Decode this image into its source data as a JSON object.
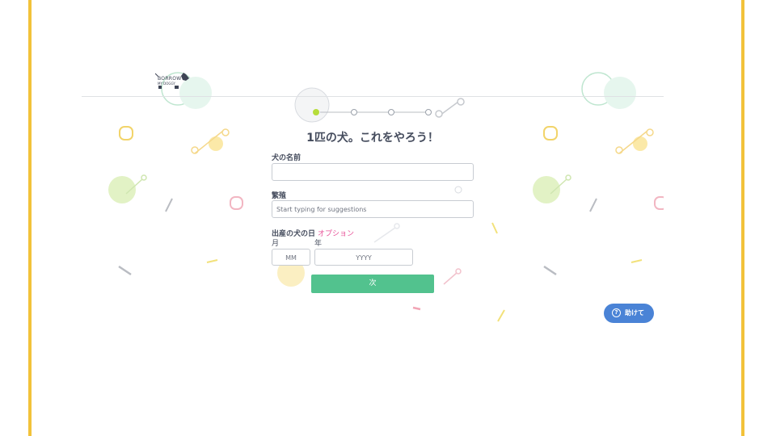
{
  "brand": {
    "logo_line1": "BORROW",
    "logo_line2": "MY DOGGY"
  },
  "progress": {
    "step": 1,
    "total_steps": 5
  },
  "form": {
    "title": "1匹の犬。これをやろう！",
    "dog_name": {
      "label": "犬の名前",
      "value": ""
    },
    "breed": {
      "label": "繁殖",
      "placeholder": "Start typing for suggestions"
    },
    "birth_date": {
      "label": "出産の犬の日",
      "optional_label": "オプション",
      "month_label": "月",
      "year_label": "年",
      "month_placeholder": "MM",
      "year_placeholder": "YYYY"
    },
    "next_button": "次"
  },
  "help_button": {
    "icon": "question-circle-icon",
    "label": "助けて"
  },
  "colors": {
    "accent_green": "#52c28e",
    "help_blue": "#4a83d6",
    "optional_pink": "#e8559a",
    "frame_yellow": "#f2c23a"
  }
}
